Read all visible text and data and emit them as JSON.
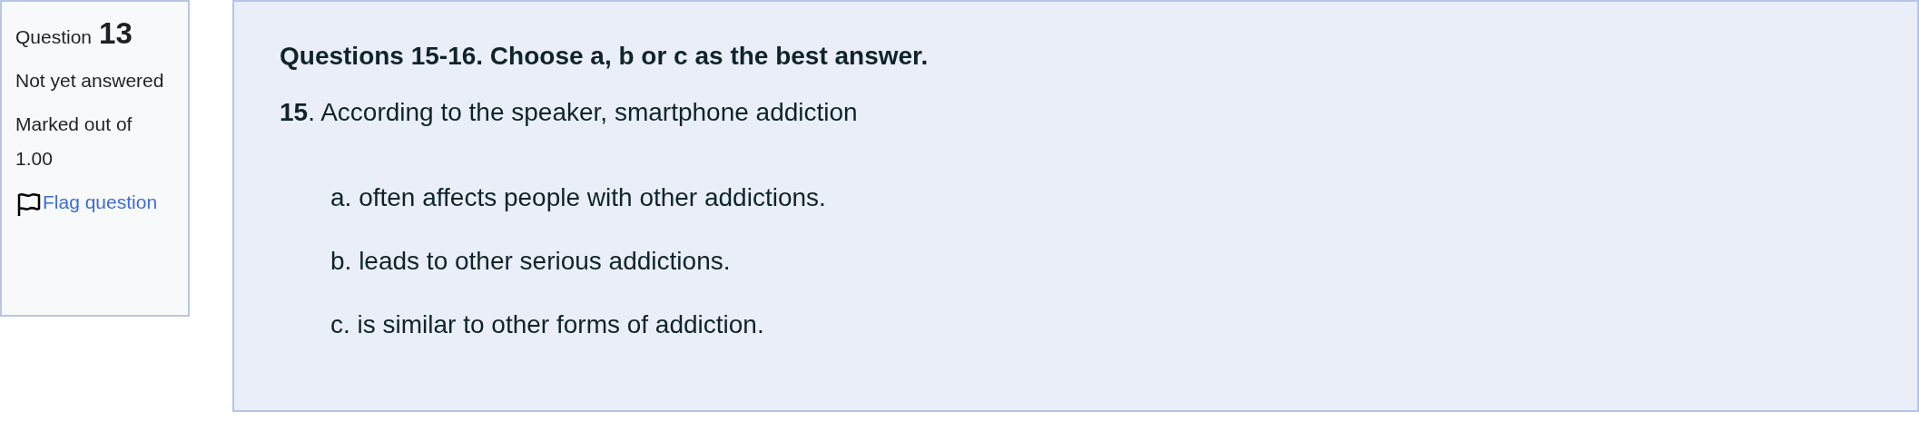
{
  "info": {
    "label": "Question",
    "number": "13",
    "status": "Not yet answered",
    "marks": "Marked out of 1.00",
    "flag_link": "Flag question"
  },
  "content": {
    "instructions": "Questions 15-16. Choose a, b or c as the best answer.",
    "question": "**15**. According to the speaker, smartphone addiction",
    "options": [
      "a. often affects people with other addictions.",
      "b. leads to other serious addictions.",
      "c. is similar to other forms of addiction."
    ]
  }
}
